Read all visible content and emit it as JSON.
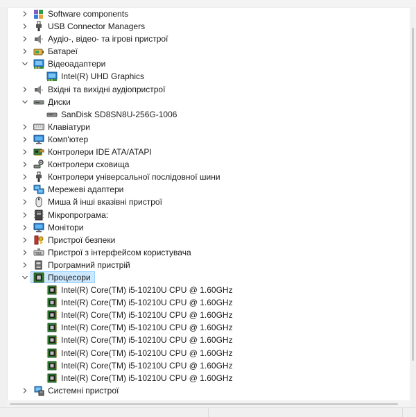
{
  "window": {
    "title": ""
  },
  "tree": [
    {
      "label": "Software components",
      "level": 0,
      "expanded": false,
      "icon": "software-components-icon"
    },
    {
      "label": "USB Connector Managers",
      "level": 0,
      "expanded": false,
      "icon": "usb-icon"
    },
    {
      "label": "Аудіо-, відео- та ігрові пристрої",
      "level": 0,
      "expanded": false,
      "icon": "speaker-icon"
    },
    {
      "label": "Батареї",
      "level": 0,
      "expanded": false,
      "icon": "battery-icon"
    },
    {
      "label": "Відеоадаптери",
      "level": 0,
      "expanded": true,
      "icon": "display-adapter-icon"
    },
    {
      "label": "Intel(R) UHD Graphics",
      "level": 1,
      "icon": "display-adapter-icon"
    },
    {
      "label": "Вхідні та вихідні аудіопристрої",
      "level": 0,
      "expanded": false,
      "icon": "speaker-icon"
    },
    {
      "label": "Диски",
      "level": 0,
      "expanded": true,
      "icon": "disk-drive-icon"
    },
    {
      "label": "SanDisk SD8SN8U-256G-1006",
      "level": 1,
      "icon": "disk-drive-icon"
    },
    {
      "label": "Клавіатури",
      "level": 0,
      "expanded": false,
      "icon": "keyboard-icon"
    },
    {
      "label": "Комп'ютер",
      "level": 0,
      "expanded": false,
      "icon": "monitor-icon"
    },
    {
      "label": "Контролери IDE ATA/ATAPI",
      "level": 0,
      "expanded": false,
      "icon": "ide-controller-icon"
    },
    {
      "label": "Контролери сховища",
      "level": 0,
      "expanded": false,
      "icon": "storage-controller-icon"
    },
    {
      "label": "Контролери універсальної послідовної шини",
      "level": 0,
      "expanded": false,
      "icon": "usb-icon"
    },
    {
      "label": "Мережеві адаптери",
      "level": 0,
      "expanded": false,
      "icon": "network-adapter-icon"
    },
    {
      "label": "Миша й інші вказівні пристрої",
      "level": 0,
      "expanded": false,
      "icon": "mouse-icon"
    },
    {
      "label": "Мікропрограма:",
      "level": 0,
      "expanded": false,
      "icon": "firmware-icon"
    },
    {
      "label": "Монітори",
      "level": 0,
      "expanded": false,
      "icon": "monitor-icon"
    },
    {
      "label": "Пристрої безпеки",
      "level": 0,
      "expanded": false,
      "icon": "security-device-icon"
    },
    {
      "label": "Пристрої з інтерфейсом користувача",
      "level": 0,
      "expanded": false,
      "icon": "hid-icon"
    },
    {
      "label": "Програмний пристрій",
      "level": 0,
      "expanded": false,
      "icon": "software-device-icon"
    },
    {
      "label": "Процесори",
      "level": 0,
      "expanded": true,
      "selected": true,
      "icon": "processor-icon"
    },
    {
      "label": "Intel(R) Core(TM) i5-10210U CPU @ 1.60GHz",
      "level": 1,
      "icon": "processor-icon"
    },
    {
      "label": "Intel(R) Core(TM) i5-10210U CPU @ 1.60GHz",
      "level": 1,
      "icon": "processor-icon"
    },
    {
      "label": "Intel(R) Core(TM) i5-10210U CPU @ 1.60GHz",
      "level": 1,
      "icon": "processor-icon"
    },
    {
      "label": "Intel(R) Core(TM) i5-10210U CPU @ 1.60GHz",
      "level": 1,
      "icon": "processor-icon"
    },
    {
      "label": "Intel(R) Core(TM) i5-10210U CPU @ 1.60GHz",
      "level": 1,
      "icon": "processor-icon"
    },
    {
      "label": "Intel(R) Core(TM) i5-10210U CPU @ 1.60GHz",
      "level": 1,
      "icon": "processor-icon"
    },
    {
      "label": "Intel(R) Core(TM) i5-10210U CPU @ 1.60GHz",
      "level": 1,
      "icon": "processor-icon"
    },
    {
      "label": "Intel(R) Core(TM) i5-10210U CPU @ 1.60GHz",
      "level": 1,
      "icon": "processor-icon"
    },
    {
      "label": "Системні пристрої",
      "level": 0,
      "expanded": false,
      "icon": "system-device-icon"
    }
  ],
  "colors": {
    "selection": "#cce8ff",
    "selection_border": "#99d1ff",
    "chevron": "#555555"
  }
}
